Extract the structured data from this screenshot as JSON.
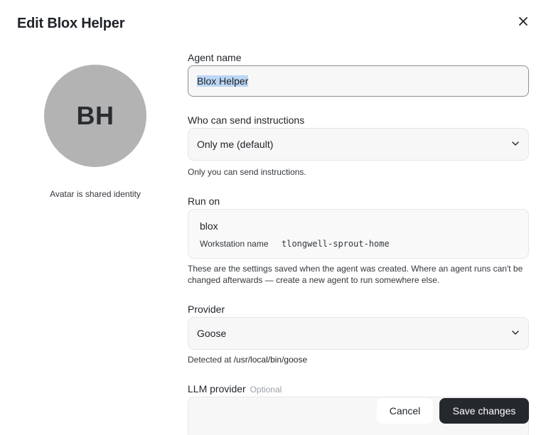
{
  "dialog": {
    "title": "Edit Blox Helper",
    "close_icon": "close-icon"
  },
  "avatar": {
    "initials": "BH",
    "caption": "Avatar is shared identity",
    "color": "#b3b3b3"
  },
  "agent_name": {
    "label": "Agent name",
    "value": "Blox Helper"
  },
  "instructions": {
    "label": "Who can send instructions",
    "selected": "Only me (default)",
    "help": "Only you can send instructions."
  },
  "run_on": {
    "label": "Run on",
    "name": "blox",
    "workstation_label": "Workstation name",
    "workstation_value": "tlongwell-sprout-home",
    "help": "These are the settings saved when the agent was created. Where an agent runs can't be changed afterwards — create a new agent to run somewhere else."
  },
  "provider": {
    "label": "Provider",
    "selected": "Goose",
    "help_prefix": "Detected at ",
    "help_path": "/usr/local/bin/goose"
  },
  "llm_provider": {
    "label": "LLM provider",
    "optional_tag": "Optional"
  },
  "footer": {
    "cancel_label": "Cancel",
    "save_label": "Save changes",
    "save_color": "#25292e"
  }
}
